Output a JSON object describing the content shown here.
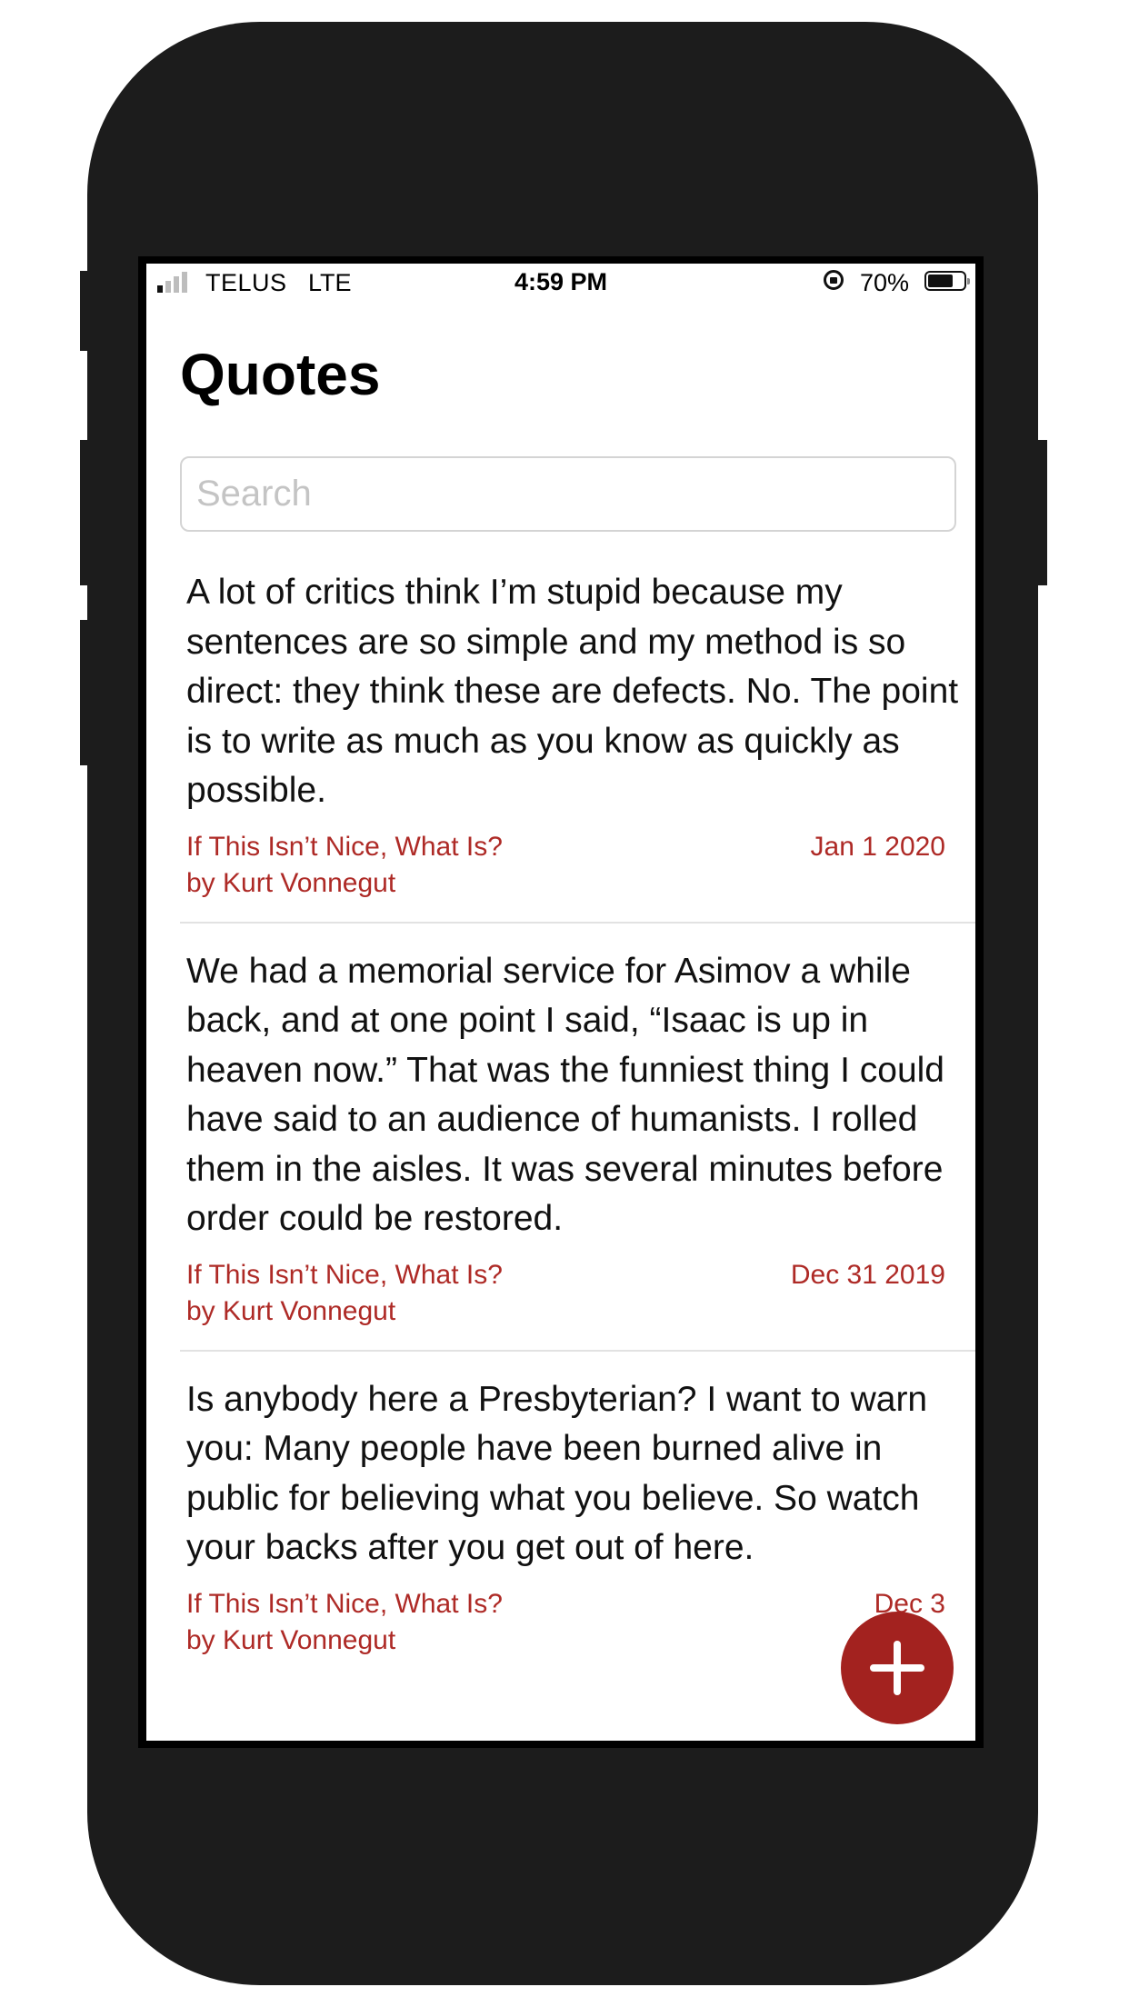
{
  "status_bar": {
    "carrier": "TELUS",
    "network": "LTE",
    "time": "4:59 PM",
    "battery_percent": "70%",
    "battery_level": 0.7,
    "signal_bars_active": 1,
    "signal_bars_total": 4
  },
  "header": {
    "title": "Quotes"
  },
  "search": {
    "placeholder": "Search",
    "value": ""
  },
  "quotes": [
    {
      "text": "A lot of critics think I’m stupid because my sentences are so simple and my method is so direct: they think these are defects. No. The point is to write as much as you know as quickly as possible.",
      "book": "If This Isn’t Nice, What Is?",
      "author": "by Kurt Vonnegut",
      "date": "Jan 1 2020"
    },
    {
      "text": "We had a memorial service for Asimov a while back, and at one point I said, “Isaac is up in heaven now.” That was the funniest thing I could have said to an audience of humanists. I rolled them in the aisles. It was several minutes before order could be restored.",
      "book": "If This Isn’t Nice, What Is?",
      "author": "by Kurt Vonnegut",
      "date": "Dec 31 2019"
    },
    {
      "text": "Is anybody here a Presbyterian? I want to warn you: Many people have been burned alive in public for believing what you believe. So watch your backs after you get out of here.",
      "book": "If This Isn’t Nice, What Is?",
      "author": "by Kurt Vonnegut",
      "date": "Dec 3"
    }
  ],
  "fab": {
    "icon": "plus-icon"
  },
  "colors": {
    "accent": "#a3221f",
    "meta_text": "#ae2a26",
    "phone_body": "#1c1c1c"
  }
}
